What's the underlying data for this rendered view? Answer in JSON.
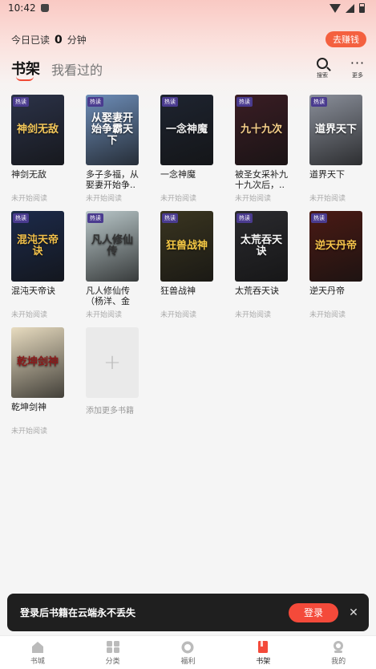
{
  "status_bar": {
    "time": "10:42"
  },
  "header": {
    "read_prefix": "今日已读",
    "read_count": "0",
    "read_suffix": "分钟",
    "earn_button": "去赚钱",
    "tab_active": "书架",
    "tab_inactive": "我看过的",
    "search_label": "搜索",
    "more_label": "更多"
  },
  "hot_label": "热读",
  "books": [
    {
      "title": "神剑无敌",
      "cover_text": "神剑无敌",
      "status": "未开始阅读",
      "hot": true,
      "bg": "#2b3248",
      "text_color": "#f3c75a"
    },
    {
      "title": "多子多福，从娶妻开始争..",
      "cover_text": "从娶妻开始争霸天下",
      "status": "未开始阅读",
      "hot": true,
      "bg": "#6d8db8",
      "text_color": "#ffffff"
    },
    {
      "title": "一念神魔",
      "cover_text": "一念神魔",
      "status": "未开始阅读",
      "hot": true,
      "bg": "#1e2430",
      "text_color": "#f0f0f0"
    },
    {
      "title": "被圣女采补九十九次后，..",
      "cover_text": "九十九次",
      "status": "未开始阅读",
      "hot": true,
      "bg": "#3a1d24",
      "text_color": "#f6d08a"
    },
    {
      "title": "道界天下",
      "cover_text": "道界天下",
      "status": "未开始阅读",
      "hot": true,
      "bg": "#8a8f9a",
      "text_color": "#ffffff"
    },
    {
      "title": "混沌天帝诀",
      "cover_text": "混沌天帝诀",
      "status": "未开始阅读",
      "hot": true,
      "bg": "#1c2a4a",
      "text_color": "#f2c04a"
    },
    {
      "title": "凡人修仙传（杨洋、金晨..",
      "cover_text": "凡人修仙传",
      "status": "未开始阅读",
      "hot": true,
      "bg": "#b9c7c9",
      "text_color": "#333333"
    },
    {
      "title": "狂兽战神",
      "cover_text": "狂兽战神",
      "status": "未开始阅读",
      "hot": true,
      "bg": "#3a3520",
      "text_color": "#f6c945"
    },
    {
      "title": "太荒吞天诀",
      "cover_text": "太荒吞天诀",
      "status": "未开始阅读",
      "hot": true,
      "bg": "#2a2a2e",
      "text_color": "#f5f5f5"
    },
    {
      "title": "逆天丹帝",
      "cover_text": "逆天丹帝",
      "status": "未开始阅读",
      "hot": true,
      "bg": "#4a1a14",
      "text_color": "#f5c34a"
    },
    {
      "title": "乾坤剑神",
      "cover_text": "乾坤剑神",
      "status": "未开始阅读",
      "hot": false,
      "bg": "#e8dcc0",
      "text_color": "#8a1a1a"
    }
  ],
  "add_more_label": "添加更多书籍",
  "toast": {
    "text": "登录后书籍在云端永不丢失",
    "login_button": "登录"
  },
  "bottom_nav": [
    {
      "label": "书城",
      "icon": "home-icon",
      "active": false
    },
    {
      "label": "分类",
      "icon": "grid-icon",
      "active": false
    },
    {
      "label": "福利",
      "icon": "gift-icon",
      "active": false
    },
    {
      "label": "书架",
      "icon": "bookshelf-icon",
      "active": true
    },
    {
      "label": "我的",
      "icon": "profile-icon",
      "active": false
    }
  ],
  "colors": {
    "accent": "#f44a3a",
    "badge": "#4a3b8f"
  }
}
